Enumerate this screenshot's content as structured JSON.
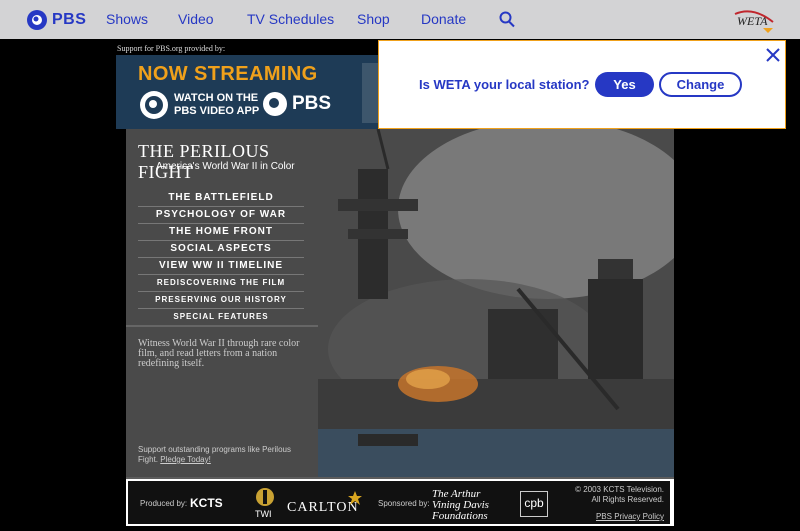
{
  "topbar": {
    "logo_text": "PBS",
    "nav": [
      "Shows",
      "Video",
      "TV Schedules",
      "Shop",
      "Donate"
    ],
    "station_logo_text": "WETA"
  },
  "sponsor": {
    "label": "Support for PBS.org provided by:",
    "banner": {
      "headline": "NOW STREAMING",
      "line1": "WATCH ON THE",
      "line2": "PBS VIDEO APP",
      "brand": "PBS"
    }
  },
  "station_modal": {
    "question": "Is WETA your local station?",
    "yes_label": "Yes",
    "change_label": "Change"
  },
  "site": {
    "title": "THE PERILOUS FIGHT",
    "subtitle": "America's World War II in Color",
    "menu": [
      "THE BATTLEFIELD",
      "PSYCHOLOGY OF WAR",
      "THE HOME FRONT",
      "SOCIAL ASPECTS",
      "VIEW WW II TIMELINE",
      "REDISCOVERING THE FILM",
      "PRESERVING OUR HISTORY",
      "SPECIAL FEATURES"
    ],
    "intro": "Witness World War II through rare color film, and read letters from a nation redefining itself.",
    "support_prefix": "Support outstanding programs like Perilous Fight.",
    "pledge_link": "Pledge Today!"
  },
  "footer": {
    "produced_by": "Produced by:",
    "kcts": "KCTS",
    "twi": "TWI",
    "carlton": "CARLTON",
    "sponsored_by": "Sponsored by:",
    "foundation_line1": "The Arthur",
    "foundation_line2": "Vining Davis",
    "foundation_line3": "Foundations",
    "cpb": "cpb",
    "copyright_line1": "© 2003 KCTS Television.",
    "copyright_line2": "All Rights Reserved.",
    "privacy": "PBS Privacy Policy"
  }
}
